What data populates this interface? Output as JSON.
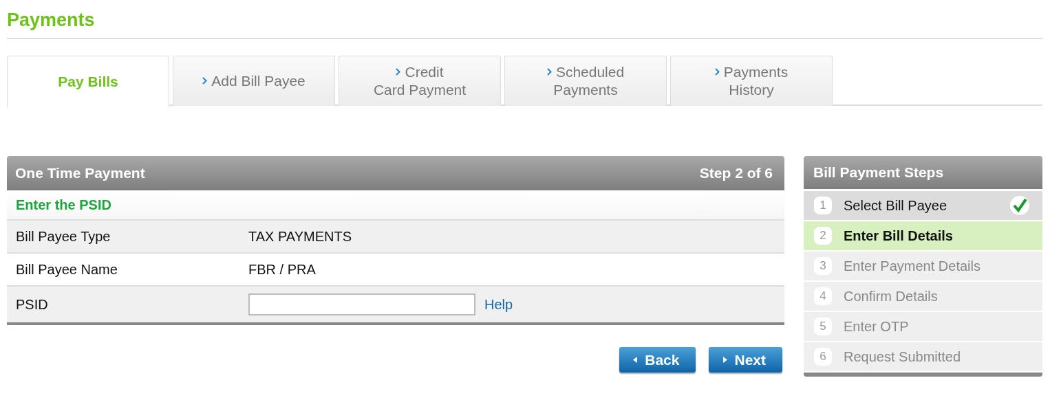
{
  "page_title": "Payments",
  "tabs": [
    {
      "selected": true,
      "lines": [
        "Pay Bills"
      ]
    },
    {
      "selected": false,
      "lines": [
        "Add Bill Payee"
      ]
    },
    {
      "selected": false,
      "lines": [
        "Credit",
        "Card Payment"
      ]
    },
    {
      "selected": false,
      "lines": [
        "Scheduled",
        "Payments"
      ]
    },
    {
      "selected": false,
      "lines": [
        "Payments",
        "History"
      ]
    }
  ],
  "panel": {
    "title": "One Time Payment",
    "step": "Step 2 of 6",
    "section": "Enter the PSID",
    "rows": [
      {
        "kind": "text",
        "label": "Bill Payee Type",
        "value": "TAX PAYMENTS"
      },
      {
        "kind": "text",
        "label": "Bill Payee Name",
        "value": "FBR / PRA"
      },
      {
        "kind": "input",
        "label": "PSID",
        "link": "Help"
      }
    ]
  },
  "buttons": [
    {
      "label": "Back",
      "kind": "back"
    },
    {
      "label": "Next",
      "kind": "next"
    }
  ],
  "steps_panel": {
    "title": "Bill Payment Steps",
    "steps": [
      {
        "number": "1",
        "label": "Select Bill Payee",
        "done": true,
        "selected": false
      },
      {
        "number": "2",
        "label": "Enter Bill Details",
        "done": false,
        "selected": true
      },
      {
        "number": "3",
        "label": "Enter Payment Details",
        "done": false,
        "selected": false
      },
      {
        "number": "4",
        "label": "Confirm Details",
        "done": false,
        "selected": false
      },
      {
        "number": "5",
        "label": "Enter OTP",
        "done": false,
        "selected": false
      },
      {
        "number": "6",
        "label": "Request Submitted",
        "done": false,
        "selected": false
      }
    ]
  }
}
